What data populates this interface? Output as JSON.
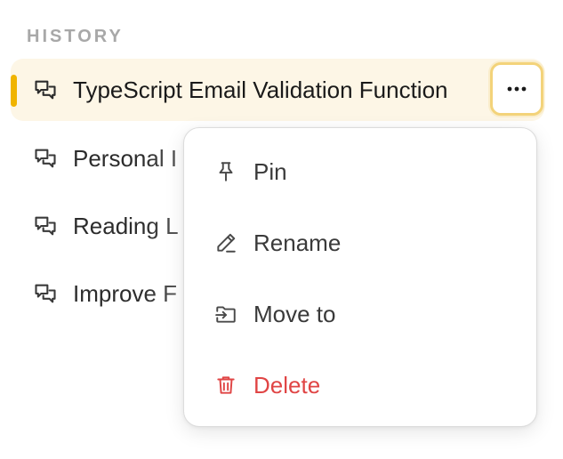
{
  "history": {
    "section_label": "HISTORY",
    "items": [
      {
        "label": "TypeScript Email Validation Function",
        "active": true
      },
      {
        "label": "Personal I"
      },
      {
        "label": "Reading L"
      },
      {
        "label": "Improve F"
      }
    ]
  },
  "context_menu": {
    "items": [
      {
        "label": "Pin",
        "icon": "pin-icon"
      },
      {
        "label": "Rename",
        "icon": "pencil-icon"
      },
      {
        "label": "Move to",
        "icon": "move-to-icon"
      },
      {
        "label": "Delete",
        "icon": "trash-icon",
        "color": "#e04545"
      }
    ]
  },
  "colors": {
    "accent": "#f0b400",
    "active_background": "#fdf6e6",
    "danger": "#e04545"
  }
}
